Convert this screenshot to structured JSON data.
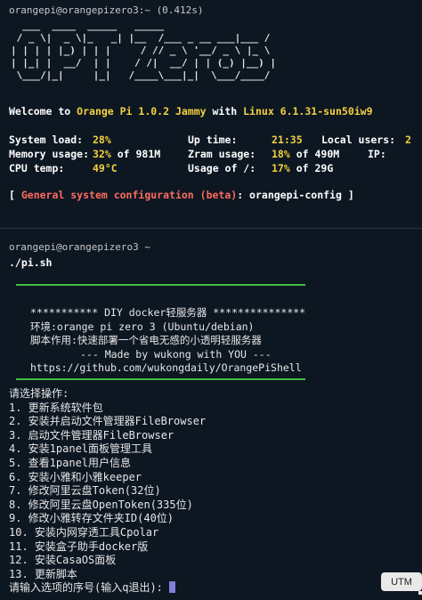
{
  "session1": {
    "prompt": "orangepi@orangepizero3:~ (0.412s)",
    "ascii_art": "  ___  ____  _____   _____\n / _ \\|  _ \\|_   _| |__  /___ _ __ ___|___ /\n| | | | |_) | | |     / // _ \\ '__/ _ \\ |_ \\\n| |_| |  __/  | |    / /|  __/ | | (_) |__) |\n \\___/|_|     |_|   /____\\___|_|  \\___/____/",
    "welcome_prefix": "Welcome to ",
    "welcome_os": "Orange Pi 1.0.2 Jammy",
    "welcome_mid": " with ",
    "welcome_kernel": "Linux 6.1.31-sun50iw9",
    "stats": {
      "system_load_label": "System load:",
      "system_load_value": "28%",
      "uptime_label": "Up time:",
      "uptime_value": "21:35",
      "local_users_label": "Local users:",
      "local_users_value": "2",
      "memory_label": "Memory usage:",
      "memory_value": "32%",
      "memory_of": " of 981M",
      "zram_label": "Zram usage:",
      "zram_value": "18%",
      "zram_of": " of 490M",
      "ip_label": "IP:",
      "cpu_temp_label": "CPU temp:",
      "cpu_temp_value": "49°C",
      "usage_root_label": "Usage of /:",
      "usage_root_value": "17%",
      "usage_root_of": " of 29G"
    },
    "config_open": "[ ",
    "config_text": "General system configuration (beta)",
    "config_colon": ": ",
    "config_cmd": "orangepi-config",
    "config_close": " ]"
  },
  "session2": {
    "prompt": "orangepi@orangepizero3 ~",
    "command": "./pi.sh",
    "banner": [
      "*********** DIY docker轻服务器 ***************",
      "环境:orange pi zero 3 (Ubuntu/debian)",
      "脚本作用:快速部署一个省电无感的小透明轻服务器",
      "--- Made by wukong with YOU ---",
      "https://github.com/wukongdaily/OrangePiShell"
    ],
    "menu_title": "请选择操作:",
    "menu_items": [
      "1. 更新系统软件包",
      "2. 安装并启动文件管理器FileBrowser",
      "3. 启动文件管理器FileBrowser",
      "4. 安装1panel面板管理工具",
      "5. 查看1panel用户信息",
      "6. 安装小雅和小雅keeper",
      "7. 修改阿里云盘Token(32位)",
      "8. 修改阿里云盘OpenToken(335位)",
      "9. 修改小雅转存文件夹ID(40位)",
      "10. 安装内网穿透工具Cpolar",
      "11. 安装盒子助手docker版",
      "12. 安装CasaOS面板",
      "13. 更新脚本"
    ],
    "input_prompt": "请输入选项的序号(输入q退出): "
  },
  "utm_badge": "UTM",
  "colors": {
    "background": "#0d1722",
    "yellow": "#f4d03f",
    "red": "#ff6b5e",
    "green_rule": "#3fbf3f",
    "cursor": "#7f7fd8"
  }
}
